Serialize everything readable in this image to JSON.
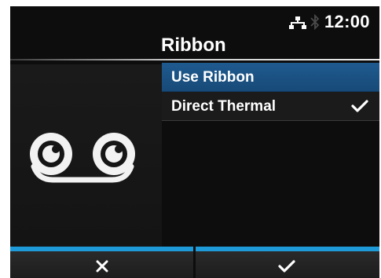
{
  "status": {
    "time": "12:00",
    "icons": [
      "network-icon",
      "bluetooth-icon"
    ]
  },
  "screen": {
    "title": "Ribbon"
  },
  "menu": {
    "items": [
      {
        "label": "Use Ribbon",
        "selected": true,
        "checked": false
      },
      {
        "label": "Direct Thermal",
        "selected": false,
        "checked": true
      }
    ]
  },
  "illustration": {
    "icon": "ribbon-icon"
  },
  "footer": {
    "cancel_icon": "close-icon",
    "ok_icon": "check-icon"
  },
  "colors": {
    "accent": "#1e9ad8",
    "selection": "#1f5a8f",
    "background": "#0d0d0d",
    "text": "#ffffff"
  }
}
